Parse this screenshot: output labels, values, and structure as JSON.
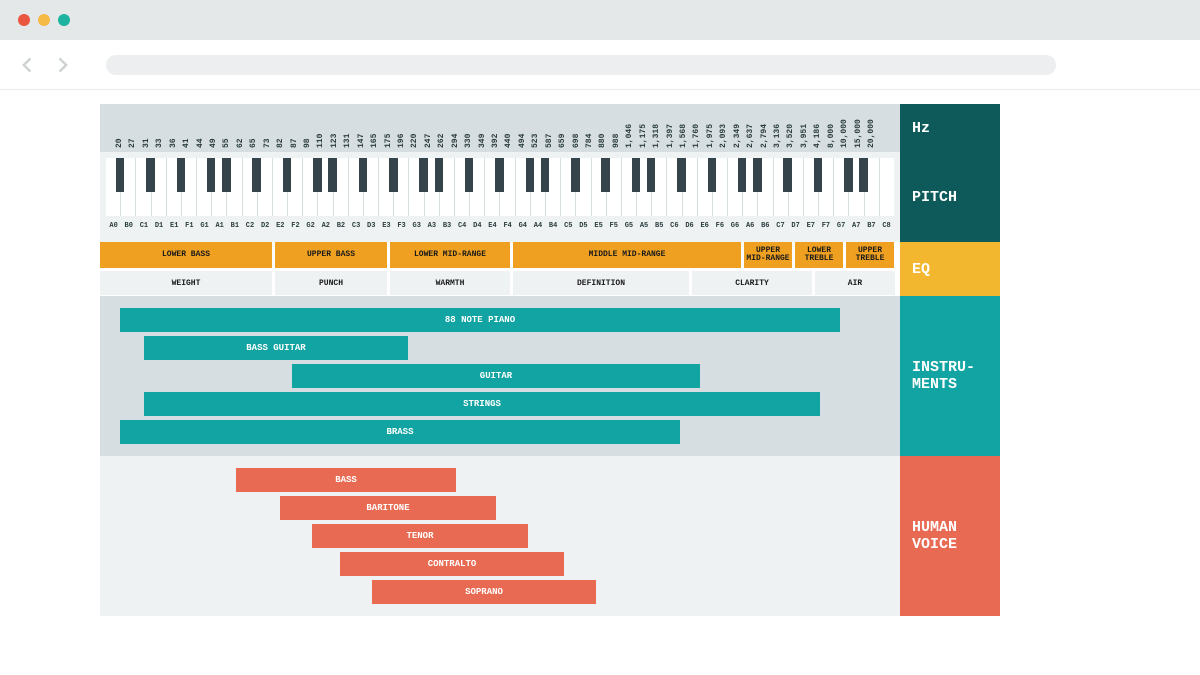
{
  "labels": {
    "hz": "Hz",
    "pitch": "PITCH",
    "eq": "EQ",
    "instruments": "INSTRU-\nMENTS",
    "voice": "HUMAN\nVOICE"
  },
  "hz_ticks": [
    "20",
    "27",
    "31",
    "33",
    "36",
    "41",
    "44",
    "49",
    "55",
    "62",
    "65",
    "73",
    "82",
    "87",
    "98",
    "110",
    "123",
    "131",
    "147",
    "165",
    "175",
    "196",
    "220",
    "247",
    "262",
    "294",
    "330",
    "349",
    "392",
    "440",
    "494",
    "523",
    "587",
    "659",
    "698",
    "784",
    "880",
    "988",
    "1,046",
    "1,175",
    "1,318",
    "1,397",
    "1,568",
    "1,760",
    "1,975",
    "2,093",
    "2,349",
    "2,637",
    "2,794",
    "3,136",
    "3,520",
    "3,951",
    "4,186",
    "8,000",
    "10,000",
    "15,000",
    "20,000"
  ],
  "notes": [
    "A0",
    "B0",
    "C1",
    "D1",
    "E1",
    "F1",
    "G1",
    "A1",
    "B1",
    "C2",
    "D2",
    "E2",
    "F2",
    "G2",
    "A2",
    "B2",
    "C3",
    "D3",
    "E3",
    "F3",
    "G3",
    "A3",
    "B3",
    "C4",
    "D4",
    "E4",
    "F4",
    "G4",
    "A4",
    "B4",
    "C5",
    "D5",
    "E5",
    "F5",
    "G5",
    "A5",
    "B5",
    "C6",
    "D6",
    "E6",
    "F6",
    "G6",
    "A6",
    "B6",
    "C7",
    "D7",
    "E7",
    "F7",
    "G7",
    "A7",
    "B7",
    "C8"
  ],
  "black_after": [
    1,
    3,
    5,
    7,
    8,
    10,
    12,
    14,
    15,
    17,
    19,
    21,
    22,
    24,
    26,
    28,
    29,
    31,
    33,
    35,
    36,
    38,
    40,
    42,
    43,
    45,
    47,
    49,
    50
  ],
  "eq_ranges": [
    {
      "label": "LOWER BASS",
      "width_pct": 21.5
    },
    {
      "label": "UPPER BASS",
      "width_pct": 14.0
    },
    {
      "label": "LOWER MID-RANGE",
      "width_pct": 15.0
    },
    {
      "label": "MIDDLE MID-RANGE",
      "width_pct": 28.5
    },
    {
      "label": "UPPER MID-RANGE",
      "width_pct": 6.0
    },
    {
      "label": "LOWER TREBLE",
      "width_pct": 6.0
    },
    {
      "label": "UPPER TREBLE",
      "width_pct": 6.0
    }
  ],
  "eq_qualities": [
    {
      "label": "WEIGHT",
      "width_pct": 21.5
    },
    {
      "label": "PUNCH",
      "width_pct": 14.0
    },
    {
      "label": "WARMTH",
      "width_pct": 15.0
    },
    {
      "label": "DEFINITION",
      "width_pct": 22.0
    },
    {
      "label": "CLARITY",
      "width_pct": 15.0
    },
    {
      "label": "AIR",
      "width_pct": 10.0
    }
  ],
  "instruments": [
    {
      "label": "88 NOTE PIANO",
      "start_pct": 2.5,
      "width_pct": 90.0
    },
    {
      "label": "BASS GUITAR",
      "start_pct": 5.5,
      "width_pct": 33.0
    },
    {
      "label": "GUITAR",
      "start_pct": 24.0,
      "width_pct": 51.0
    },
    {
      "label": "STRINGS",
      "start_pct": 5.5,
      "width_pct": 84.5
    },
    {
      "label": "BRASS",
      "start_pct": 2.5,
      "width_pct": 70.0
    }
  ],
  "voices": [
    {
      "label": "BASS",
      "start_pct": 17.0,
      "width_pct": 27.5
    },
    {
      "label": "BARITONE",
      "start_pct": 22.5,
      "width_pct": 27.0
    },
    {
      "label": "TENOR",
      "start_pct": 26.5,
      "width_pct": 27.0
    },
    {
      "label": "CONTRALTO",
      "start_pct": 30.0,
      "width_pct": 28.0
    },
    {
      "label": "SOPRANO",
      "start_pct": 34.0,
      "width_pct": 28.0
    }
  ],
  "chart_data": {
    "type": "table",
    "title": "Audio Frequency Spectrum Reference",
    "hz_scale": {
      "min": 20,
      "max": 20000,
      "ticks": [
        "20",
        "27",
        "31",
        "33",
        "36",
        "41",
        "44",
        "49",
        "55",
        "62",
        "65",
        "73",
        "82",
        "87",
        "98",
        "110",
        "123",
        "131",
        "147",
        "165",
        "175",
        "196",
        "220",
        "247",
        "262",
        "294",
        "330",
        "349",
        "392",
        "440",
        "494",
        "523",
        "587",
        "659",
        "698",
        "784",
        "880",
        "988",
        "1046",
        "1175",
        "1318",
        "1397",
        "1568",
        "1760",
        "1975",
        "2093",
        "2349",
        "2637",
        "2794",
        "3136",
        "3520",
        "3951",
        "4186",
        "8000",
        "10000",
        "15000",
        "20000"
      ]
    },
    "pitch_notes_white": [
      "A0",
      "B0",
      "C1",
      "D1",
      "E1",
      "F1",
      "G1",
      "A1",
      "B1",
      "C2",
      "D2",
      "E2",
      "F2",
      "G2",
      "A2",
      "B2",
      "C3",
      "D3",
      "E3",
      "F3",
      "G3",
      "A3",
      "B3",
      "C4",
      "D4",
      "E4",
      "F4",
      "G4",
      "A4",
      "B4",
      "C5",
      "D5",
      "E5",
      "F5",
      "G5",
      "A5",
      "B5",
      "C6",
      "D6",
      "E6",
      "F6",
      "G6",
      "A6",
      "B6",
      "C7",
      "D7",
      "E7",
      "F7",
      "G7",
      "A7",
      "B7",
      "C8"
    ],
    "eq_bands": [
      {
        "name": "LOWER BASS",
        "approx_hz": [
          20,
          60
        ],
        "quality": "WEIGHT"
      },
      {
        "name": "UPPER BASS",
        "approx_hz": [
          60,
          150
        ],
        "quality": "PUNCH"
      },
      {
        "name": "LOWER MID-RANGE",
        "approx_hz": [
          150,
          400
        ],
        "quality": "WARMTH"
      },
      {
        "name": "MIDDLE MID-RANGE",
        "approx_hz": [
          400,
          2000
        ],
        "quality": "DEFINITION"
      },
      {
        "name": "UPPER MID-RANGE",
        "approx_hz": [
          2000,
          4000
        ],
        "quality": "CLARITY"
      },
      {
        "name": "LOWER TREBLE",
        "approx_hz": [
          4000,
          8000
        ],
        "quality": "AIR"
      },
      {
        "name": "UPPER TREBLE",
        "approx_hz": [
          8000,
          20000
        ],
        "quality": "AIR"
      }
    ],
    "instruments_range_hz": [
      {
        "name": "88 NOTE PIANO",
        "low": 27,
        "high": 4186
      },
      {
        "name": "BASS GUITAR",
        "low": 41,
        "high": 330
      },
      {
        "name": "GUITAR",
        "low": 82,
        "high": 1175
      },
      {
        "name": "STRINGS",
        "low": 41,
        "high": 3520
      },
      {
        "name": "BRASS",
        "low": 27,
        "high": 988
      }
    ],
    "human_voice_range_hz": [
      {
        "name": "BASS",
        "low": 82,
        "high": 330
      },
      {
        "name": "BARITONE",
        "low": 110,
        "high": 440
      },
      {
        "name": "TENOR",
        "low": 131,
        "high": 523
      },
      {
        "name": "CONTRALTO",
        "low": 165,
        "high": 698
      },
      {
        "name": "SOPRANO",
        "low": 220,
        "high": 880
      }
    ]
  }
}
